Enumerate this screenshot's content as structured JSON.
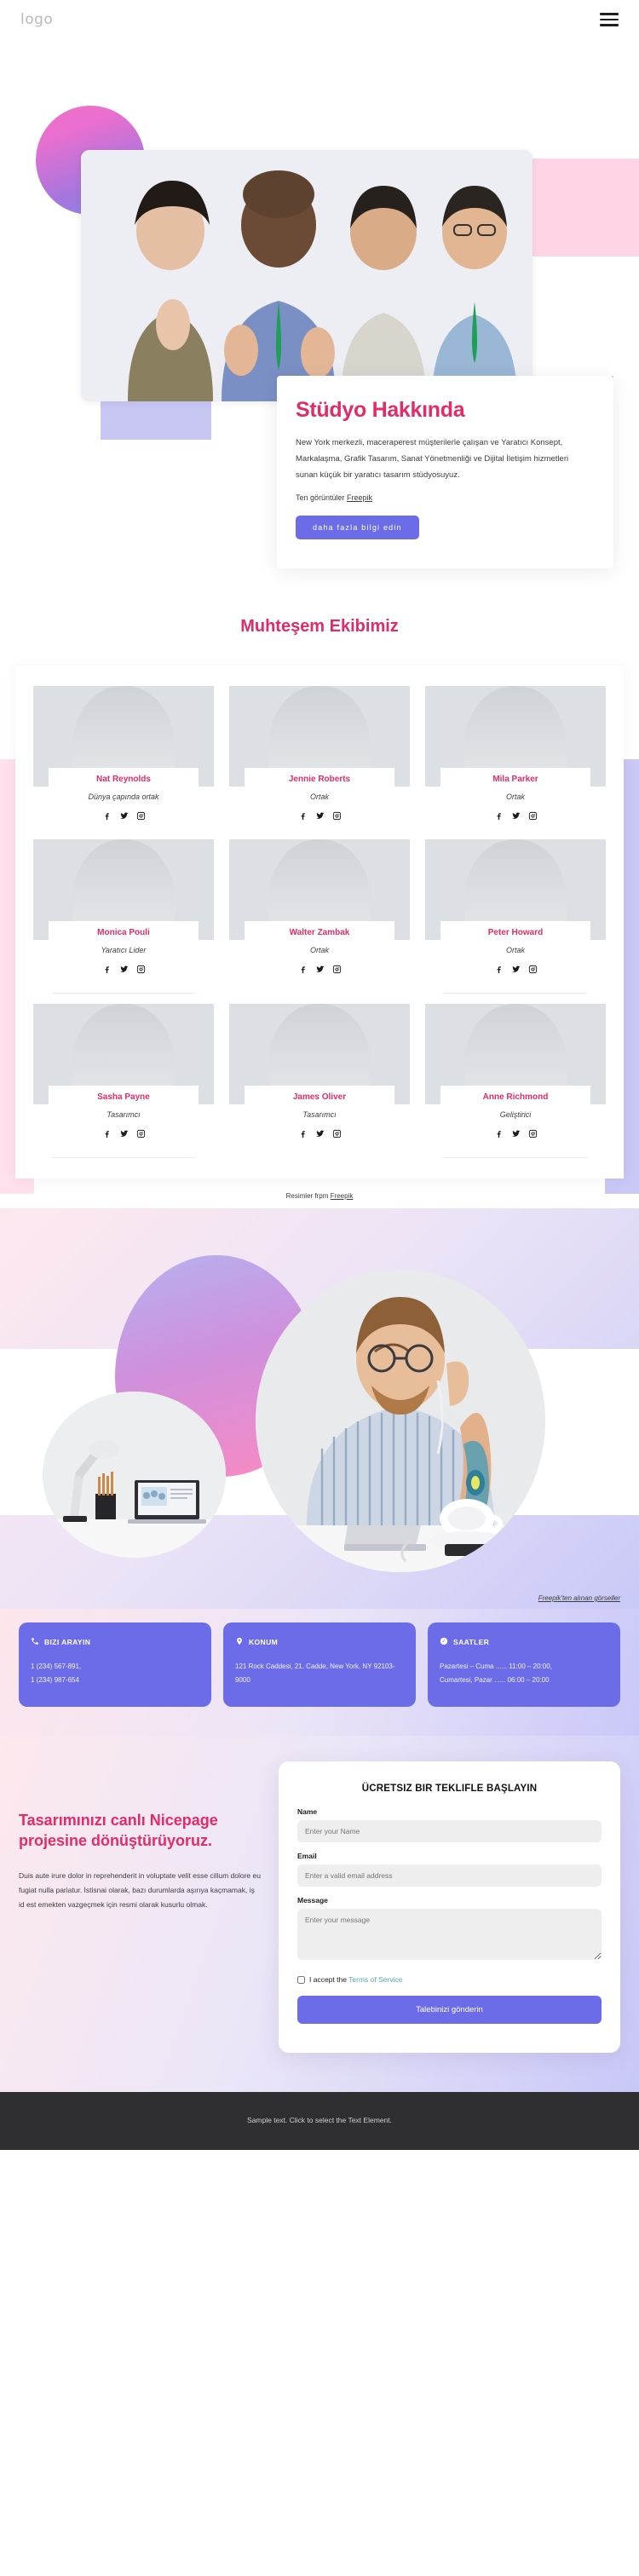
{
  "header": {
    "logo": "logo",
    "menu_icon": "hamburger-menu-icon"
  },
  "hero": {
    "title": "Stüdyo Hakkında",
    "paragraph": "New York merkezli, maceraperest müşterilerle çalışan ve Yaratıcı Konsept, Markalaşma, Grafik Tasarım, Sanat Yönetmenliği ve Dijital İletişim hizmetleri sunan küçük bir yaratıcı tasarım stüdyosuyuz.",
    "credit_prefix": "Ten görüntüler ",
    "credit_link": "Freepik",
    "button": "daha fazla bilgi edin"
  },
  "team": {
    "title": "Muhteşem Ekibimiz",
    "credit_prefix": "Resimler frpm ",
    "credit_link": "Freepik",
    "members": [
      {
        "name": "Nat Reynolds",
        "role": "Dünya çapında ortak"
      },
      {
        "name": "Jennie Roberts",
        "role": "Ortak"
      },
      {
        "name": "Mila Parker",
        "role": "Ortak"
      },
      {
        "name": "Monica Pouli",
        "role": "Yaratıcı Lider"
      },
      {
        "name": "Walter Zambak",
        "role": "Ortak"
      },
      {
        "name": "Peter Howard",
        "role": "Ortak"
      },
      {
        "name": "Sasha Payne",
        "role": "Tasarımcı"
      },
      {
        "name": "James Oliver",
        "role": "Tasarımcı"
      },
      {
        "name": "Anne Richmond",
        "role": "Geliştirici"
      }
    ],
    "social_icons": [
      "facebook-icon",
      "twitter-icon",
      "instagram-icon"
    ]
  },
  "showcase": {
    "credit": "Freepik'ten alınan görseller"
  },
  "contact_cards": [
    {
      "icon": "phone-icon",
      "title": "BIZI ARAYIN",
      "body": "1 (234) 567-891,\n1 (234) 987-654"
    },
    {
      "icon": "location-pin-icon",
      "title": "KONUM",
      "body": "121 Rock Caddesi, 21. Cadde, New York, NY 92103-9000"
    },
    {
      "icon": "clock-icon",
      "title": "SAATLER",
      "body": "Pazartesi – Cuma ...... 11:00 – 20:00,\nCumartesi, Pazar  ...... 06:00 – 20:00"
    }
  ],
  "cta": {
    "title": "Tasarımınızı canlı Nicepage projesine dönüştürüyoruz.",
    "paragraph": "Duis aute irure dolor in reprehenderit in voluptate velit esse cillum dolore eu fugiat nulla pariatur. İstisnai olarak, bazı durumlarda aşırıya kaçmamak, iş id est emekten vazgeçmek için resmi olarak kusurlu olmak."
  },
  "form": {
    "title": "ÜCRETSIZ BIR TEKLIFLE BAŞLAYIN",
    "name_label": "Name",
    "name_placeholder": "Enter your Name",
    "email_label": "Email",
    "email_placeholder": "Enter a valid email address",
    "message_label": "Message",
    "message_placeholder": "Enter your message",
    "accept_text": "I accept the ",
    "terms_link": "Terms of Service",
    "submit": "Talebinizi gönderin"
  },
  "footer": {
    "text": "Sample text. Click to select the Text Element."
  },
  "colors": {
    "accent_pink": "#e32b67",
    "accent_purple": "#6c6ce8",
    "link_teal": "#55aab5",
    "footer_bg": "#2f2f31"
  }
}
